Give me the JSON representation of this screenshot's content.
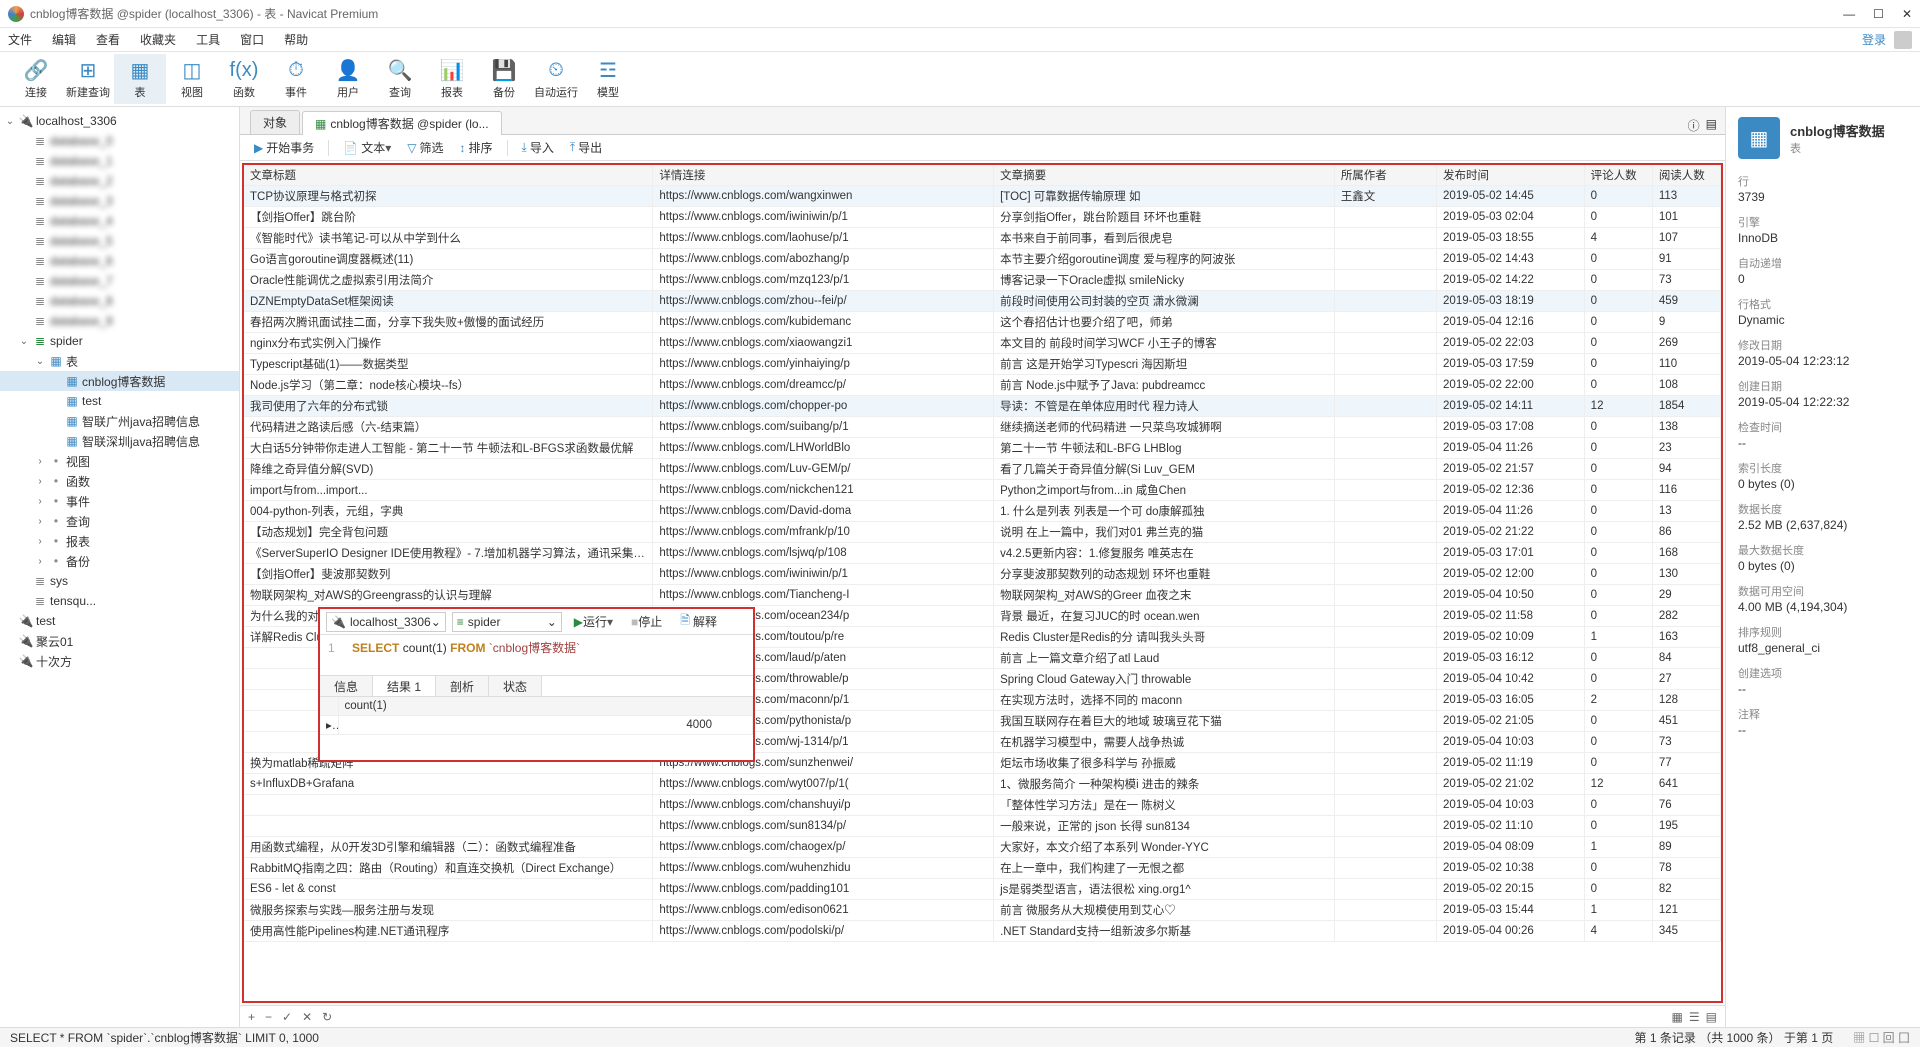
{
  "title": "cnblog博客数据 @spider (localhost_3306) - 表 - Navicat Premium",
  "menus": [
    "文件",
    "编辑",
    "查看",
    "收藏夹",
    "工具",
    "窗口",
    "帮助"
  ],
  "login": "登录",
  "toolbar": [
    {
      "icon": "🔗",
      "label": "连接",
      "name": "connection"
    },
    {
      "icon": "⊞",
      "label": "新建查询",
      "name": "new-query"
    },
    {
      "icon": "▦",
      "label": "表",
      "name": "table",
      "on": true
    },
    {
      "icon": "◫",
      "label": "视图",
      "name": "view"
    },
    {
      "icon": "f(x)",
      "label": "函数",
      "name": "function"
    },
    {
      "icon": "⏱",
      "label": "事件",
      "name": "event"
    },
    {
      "icon": "👤",
      "label": "用户",
      "name": "user"
    },
    {
      "icon": "🔍",
      "label": "查询",
      "name": "query"
    },
    {
      "icon": "📊",
      "label": "报表",
      "name": "report"
    },
    {
      "icon": "💾",
      "label": "备份",
      "name": "backup"
    },
    {
      "icon": "⏲",
      "label": "自动运行",
      "name": "autorun"
    },
    {
      "icon": "☲",
      "label": "模型",
      "name": "model"
    }
  ],
  "tree_top": "localhost_3306",
  "tree_spider": "spider",
  "tree_tables": "表",
  "tree_items": [
    "cnblog博客数据",
    "test",
    "智联广州java招聘信息",
    "智联深圳java招聘信息"
  ],
  "tree_sub": [
    "视图",
    "函数",
    "事件",
    "查询",
    "报表",
    "备份"
  ],
  "tree_other_dbs": [
    "sys",
    "tensqu..."
  ],
  "tree_other_conn": [
    "test",
    "聚云01",
    "十次方"
  ],
  "tabs": {
    "obj": "对象",
    "data": "cnblog博客数据 @spider (lo..."
  },
  "subtb": {
    "begin": "开始事务",
    "text": "文本",
    "filter": "筛选",
    "sort": "排序",
    "import": "导入",
    "export": "导出"
  },
  "cols": [
    "文章标题",
    "详情连接",
    "文章摘要",
    "所属作者",
    "发布时间",
    "评论人数",
    "阅读人数"
  ],
  "rows": [
    [
      "TCP协议原理与格式初探",
      "https://www.cnblogs.com/wangxinwen",
      "[TOC] 可靠数据传输原理 如",
      "王鑫文",
      "2019-05-02 14:45",
      "0",
      "113",
      true
    ],
    [
      "【剑指Offer】跳台阶",
      "https://www.cnblogs.com/iwiniwin/p/1",
      "分享剑指Offer，跳台阶题目 环坏也重鞋",
      "",
      "2019-05-03 02:04",
      "0",
      "101",
      false
    ],
    [
      "《智能时代》读书笔记-可以从中学到什么",
      "https://www.cnblogs.com/laohuse/p/1",
      "本书来自于前同事，看到后很虎皂",
      "",
      "2019-05-03 18:55",
      "4",
      "107",
      false
    ],
    [
      "Go语言goroutine调度器概述(11)",
      "https://www.cnblogs.com/abozhang/p",
      "本节主要介绍goroutine调度 爱与程序的阿波张",
      "",
      "2019-05-02 14:43",
      "0",
      "91",
      false
    ],
    [
      "Oracle性能调优之虚拟索引用法简介",
      "https://www.cnblogs.com/mzq123/p/1",
      "博客记录一下Oracle虚拟 smileNicky",
      "",
      "2019-05-02 14:22",
      "0",
      "73",
      false
    ],
    [
      "DZNEmptyDataSet框架阅读",
      "https://www.cnblogs.com/zhou--fei/p/",
      "前段时间使用公司封装的空页 潇水微澜",
      "",
      "2019-05-03 18:19",
      "0",
      "459",
      true
    ],
    [
      "春招两次腾讯面试挂二面，分享下我失败+傲慢的面试经历",
      "https://www.cnblogs.com/kubidemanc",
      "这个春招估计也要介绍了吧，师弟",
      "",
      "2019-05-04 12:16",
      "0",
      "9",
      false
    ],
    [
      "nginx分布式实例入门操作",
      "https://www.cnblogs.com/xiaowangzi1",
      "本文目的 前段时间学习WCF 小王子的博客",
      "",
      "2019-05-02 22:03",
      "0",
      "269",
      false
    ],
    [
      "Typescript基础(1)——数据类型",
      "https://www.cnblogs.com/yinhaiying/p",
      "前言 这是开始学习Typescri 海因斯坦",
      "",
      "2019-05-03 17:59",
      "0",
      "110",
      false
    ],
    [
      "Node.js学习（第二章：node核心模块--fs）",
      "https://www.cnblogs.com/dreamcc/p/",
      "前言 Node.js中赋予了Java: pubdreamcc",
      "",
      "2019-05-02 22:00",
      "0",
      "108",
      false
    ],
    [
      "我司使用了六年的分布式锁",
      "https://www.cnblogs.com/chopper-po",
      "导读：不管是在单体应用时代 程力诗人",
      "",
      "2019-05-02 14:11",
      "12",
      "1854",
      true
    ],
    [
      "代码精进之路读后感（六-结束篇）",
      "https://www.cnblogs.com/suibang/p/1",
      "继续摘送老师的代码精进 一只菜鸟攻城狮啊",
      "",
      "2019-05-03 17:08",
      "0",
      "138",
      false
    ],
    [
      "大白话5分钟带你走进人工智能 - 第二十一节 牛顿法和L-BFGS求函数最优解",
      "https://www.cnblogs.com/LHWorldBlo",
      "第二十一节 牛顿法和L-BFG LHBlog",
      "",
      "2019-05-04 11:26",
      "0",
      "23",
      false
    ],
    [
      "降维之奇异值分解(SVD)",
      "https://www.cnblogs.com/Luv-GEM/p/",
      "看了几篇关于奇异值分解(Si Luv_GEM",
      "",
      "2019-05-02 21:57",
      "0",
      "94",
      false
    ],
    [
      "import与from...import...",
      "https://www.cnblogs.com/nickchen121",
      "Python之import与from...in 咸鱼Chen",
      "",
      "2019-05-02 12:36",
      "0",
      "116",
      false
    ],
    [
      "004-python-列表，元组，字典",
      "https://www.cnblogs.com/David-doma",
      "1. 什么是列表 列表是一个可 do康解孤独",
      "",
      "2019-05-04 11:26",
      "0",
      "13",
      false
    ],
    [
      "【动态规划】完全背包问题",
      "https://www.cnblogs.com/mfrank/p/10",
      "说明 在上一篇中，我们对01 弗兰克的猫",
      "",
      "2019-05-02 21:22",
      "0",
      "86",
      false
    ],
    [
      "《ServerSuperIO Designer IDE使用教程》- 7.增加机器学习算法，通讯采集数据与算",
      "https://www.cnblogs.com/lsjwq/p/108",
      "v4.2.5更新内容：1.修复服务 唯英志在",
      "",
      "2019-05-03 17:01",
      "0",
      "168",
      false
    ],
    [
      "【剑指Offer】斐波那契数列",
      "https://www.cnblogs.com/iwiniwin/p/1",
      "分享斐波那契数列的动态规划 环坏也重鞋",
      "",
      "2019-05-02 12:00",
      "0",
      "130",
      false
    ],
    [
      "物联网架构_对AWS的Greengrass的认识与理解",
      "https://www.cnblogs.com/Tiancheng-I",
      "物联网架构_对AWS的Greer 血夜之末",
      "",
      "2019-05-04 10:50",
      "0",
      "29",
      false
    ],
    [
      "为什么我的对象被 IntelliJ IDEA 悄悄的修改了？",
      "https://www.cnblogs.com/ocean234/p",
      "背景 最近，在复习JUC的时 ocean.wen",
      "",
      "2019-05-02 11:58",
      "0",
      "282",
      false
    ],
    [
      "详解Redis Cluster集群",
      "https://www.cnblogs.com/toutou/p/re",
      "Redis Cluster是Redis的分 请叫我头头哥",
      "",
      "2019-05-02 10:09",
      "1",
      "163",
      false
    ],
    [
      "",
      "https://www.cnblogs.com/laud/p/aten",
      "前言 上一篇文章介绍了atl Laud",
      "",
      "2019-05-03 16:12",
      "0",
      "84",
      false
    ],
    [
      "",
      "https://www.cnblogs.com/throwable/p",
      "Spring Cloud Gateway入门 throwable",
      "",
      "2019-05-04 10:42",
      "0",
      "27",
      false
    ],
    [
      "",
      "https://www.cnblogs.com/maconn/p/1",
      "在实现方法时，选择不同的 maconn",
      "",
      "2019-05-03 16:05",
      "2",
      "128",
      false
    ],
    [
      "",
      "https://www.cnblogs.com/pythonista/p",
      "我国互联网存在着巨大的地域 玻璃豆花下猫",
      "",
      "2019-05-02 21:05",
      "0",
      "451",
      false
    ],
    [
      "",
      "https://www.cnblogs.com/wj-1314/p/1",
      "在机器学习模型中，需要人战争热诚",
      "",
      "2019-05-04 10:03",
      "0",
      "73",
      false
    ],
    [
      "换为matlab稀疏矩阵",
      "https://www.cnblogs.com/sunzhenwei/",
      "炬坛市场收集了很多科学与 孙振威",
      "",
      "2019-05-02 11:19",
      "0",
      "77",
      false
    ],
    [
      "s+InfluxDB+Grafana",
      "https://www.cnblogs.com/wyt007/p/1(",
      "1、微服务简介 一种架构模i 进击的辣条",
      "",
      "2019-05-02 21:02",
      "12",
      "641",
      false
    ],
    [
      "",
      "https://www.cnblogs.com/chanshuyi/p",
      "「整体性学习方法」是在一 陈树义",
      "",
      "2019-05-04 10:03",
      "0",
      "76",
      false
    ],
    [
      "",
      "https://www.cnblogs.com/sun8134/p/",
      "一般来说，正常的 json 长得 sun8134",
      "",
      "2019-05-02 11:10",
      "0",
      "195",
      false
    ],
    [
      "用函数式编程，从0开发3D引擎和编辑器（二）：函数式编程准备",
      "https://www.cnblogs.com/chaogex/p/",
      "大家好，本文介绍了本系列 Wonder-YYC",
      "",
      "2019-05-04 08:09",
      "1",
      "89",
      false
    ],
    [
      "RabbitMQ指南之四：路由（Routing）和直连交换机（Direct Exchange）",
      "https://www.cnblogs.com/wuhenzhidu",
      "在上一章中，我们构建了一无恨之都",
      "",
      "2019-05-02 10:38",
      "0",
      "78",
      false
    ],
    [
      "ES6 - let & const",
      "https://www.cnblogs.com/padding101",
      "js是弱类型语言，语法很松 xing.org1^",
      "",
      "2019-05-02 20:15",
      "0",
      "82",
      false
    ],
    [
      "微服务探索与实践—服务注册与发现",
      "https://www.cnblogs.com/edison0621",
      "前言 微服务从大规模使用到艾心♡",
      "",
      "2019-05-03 15:44",
      "1",
      "121",
      false
    ],
    [
      "使用高性能Pipelines构建.NET通讯程序",
      "https://www.cnblogs.com/podolski/p/",
      ".NET Standard支持一组新波多尔斯基",
      "",
      "2019-05-04 00:26",
      "4",
      "345",
      false
    ]
  ],
  "footer_nav": [
    "+",
    "−",
    "✓",
    "✕",
    "↻"
  ],
  "footer_view": [
    "▦",
    "☰",
    "▤"
  ],
  "status_sql": "SELECT * FROM `spider`.`cnblog博客数据` LIMIT 0, 1000",
  "status_right": "第 1 条记录 （共 1000 条） 于第 1 页",
  "qpanel": {
    "conn": "localhost_3306",
    "db": "spider",
    "run": "运行",
    "stop": "停止",
    "explain": "解释",
    "sql": {
      "ln": "1",
      "kw1": "SELECT",
      "fn": "count",
      "arg": "1",
      "kw2": "FROM",
      "tbl": "`cnblog博客数据`"
    },
    "tabs": [
      "信息",
      "结果 1",
      "剖析",
      "状态"
    ],
    "col": "count(1)",
    "val": "4000"
  },
  "rpanel": {
    "title": "cnblog博客数据",
    "sub": "表",
    "props": [
      {
        "k": "行",
        "v": "3739"
      },
      {
        "k": "引擎",
        "v": "InnoDB"
      },
      {
        "k": "自动递增",
        "v": "0"
      },
      {
        "k": "行格式",
        "v": "Dynamic"
      },
      {
        "k": "修改日期",
        "v": "2019-05-04 12:23:12"
      },
      {
        "k": "创建日期",
        "v": "2019-05-04 12:22:32"
      },
      {
        "k": "检查时间",
        "v": "--"
      },
      {
        "k": "索引长度",
        "v": "0 bytes (0)"
      },
      {
        "k": "数据长度",
        "v": "2.52 MB (2,637,824)"
      },
      {
        "k": "最大数据长度",
        "v": "0 bytes (0)"
      },
      {
        "k": "数据可用空间",
        "v": "4.00 MB (4,194,304)"
      },
      {
        "k": "排序规则",
        "v": "utf8_general_ci"
      },
      {
        "k": "创建选项",
        "v": "--"
      },
      {
        "k": "注释",
        "v": "--"
      }
    ]
  }
}
